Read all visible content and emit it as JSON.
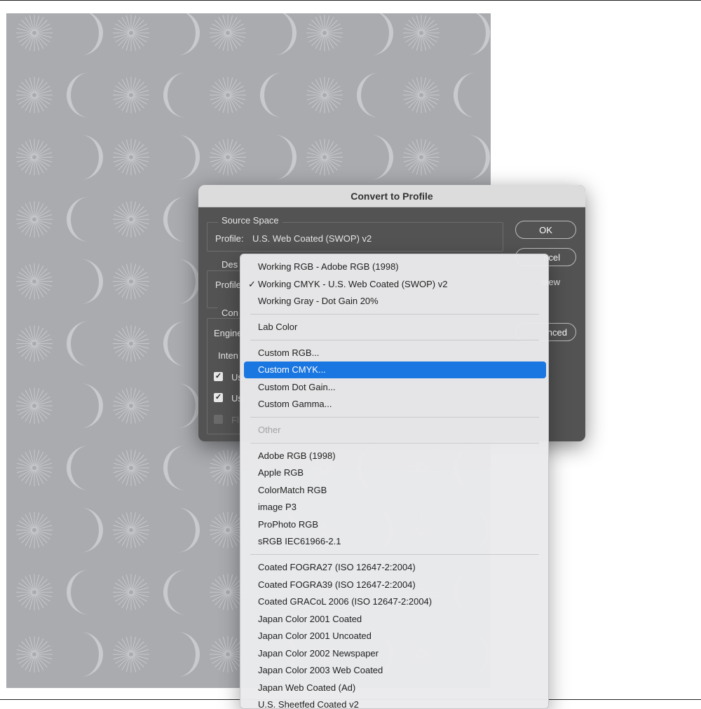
{
  "dialog": {
    "title": "Convert to Profile",
    "source_space": {
      "legend": "Source Space",
      "profile_label": "Profile:",
      "profile_value": "U.S. Web Coated (SWOP) v2"
    },
    "destination_legend_partial": "Des",
    "destination_profile_partial": "Profile",
    "conversion_legend_partial": "Con",
    "engine_partial": "Engine",
    "intent_partial": "Inten",
    "check1_partial": "Us",
    "check2_partial": "Us",
    "check3_partial": "Fl",
    "buttons": {
      "ok": "OK",
      "cancel_partial": "ncel",
      "preview_partial": "view",
      "advanced_partial": "nced"
    }
  },
  "menu": {
    "groups": [
      [
        {
          "label": "Working RGB - Adobe RGB (1998)",
          "checked": false
        },
        {
          "label": "Working CMYK - U.S. Web Coated (SWOP) v2",
          "checked": true
        },
        {
          "label": "Working Gray - Dot Gain 20%",
          "checked": false
        }
      ],
      [
        {
          "label": "Lab Color"
        }
      ],
      [
        {
          "label": "Custom RGB..."
        },
        {
          "label": "Custom CMYK...",
          "selected": true
        },
        {
          "label": "Custom Dot Gain..."
        },
        {
          "label": "Custom Gamma..."
        }
      ],
      [
        {
          "label": "Other",
          "disabled": true
        }
      ],
      [
        {
          "label": "Adobe RGB (1998)"
        },
        {
          "label": "Apple RGB"
        },
        {
          "label": "ColorMatch RGB"
        },
        {
          "label": "image P3"
        },
        {
          "label": "ProPhoto RGB"
        },
        {
          "label": "sRGB IEC61966-2.1"
        }
      ],
      [
        {
          "label": "Coated FOGRA27 (ISO 12647-2:2004)"
        },
        {
          "label": "Coated FOGRA39 (ISO 12647-2:2004)"
        },
        {
          "label": "Coated GRACoL 2006 (ISO 12647-2:2004)"
        },
        {
          "label": "Japan Color 2001 Coated"
        },
        {
          "label": "Japan Color 2001 Uncoated"
        },
        {
          "label": "Japan Color 2002 Newspaper"
        },
        {
          "label": "Japan Color 2003 Web Coated"
        },
        {
          "label": "Japan Web Coated (Ad)"
        },
        {
          "label": "U.S. Sheetfed Coated v2"
        }
      ]
    ]
  },
  "colors": {
    "canvas": "#a9abaf",
    "pattern": "#c9cacd",
    "dialog_bg": "#535353",
    "menu_highlight": "#1a76e0"
  }
}
